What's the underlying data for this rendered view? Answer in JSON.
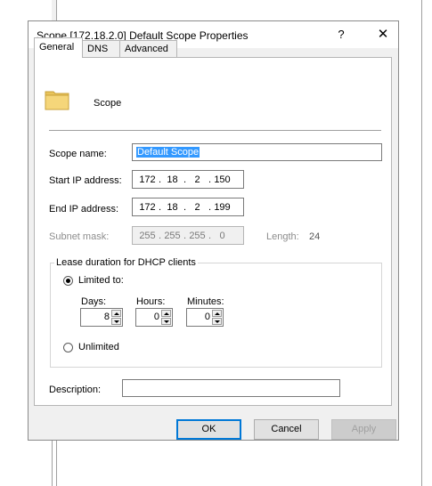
{
  "window": {
    "title": "Scope [172.18.2.0] Default Scope Properties",
    "help_glyph": "?",
    "close_glyph": "✕"
  },
  "tabs": [
    {
      "label": "General",
      "active": true
    },
    {
      "label": "DNS",
      "active": false
    },
    {
      "label": "Advanced",
      "active": false
    }
  ],
  "header": {
    "icon": "folder-icon",
    "label": "Scope"
  },
  "form": {
    "scope_name_label": "Scope name:",
    "scope_name_value": "Default Scope",
    "start_ip_label": "Start IP address:",
    "start_ip": [
      "172",
      "18",
      "2",
      "150"
    ],
    "end_ip_label": "End IP address:",
    "end_ip": [
      "172",
      "18",
      "2",
      "199"
    ],
    "subnet_label": "Subnet mask:",
    "subnet": [
      "255",
      "255",
      "255",
      "0"
    ],
    "length_label": "Length:",
    "length_value": "24"
  },
  "lease": {
    "group_label": "Lease duration for DHCP clients",
    "limited_label": "Limited to:",
    "days_label": "Days:",
    "days_value": "8",
    "hours_label": "Hours:",
    "hours_value": "0",
    "minutes_label": "Minutes:",
    "minutes_value": "0",
    "unlimited_label": "Unlimited"
  },
  "description": {
    "label": "Description:",
    "value": ""
  },
  "buttons": {
    "ok": "OK",
    "cancel": "Cancel",
    "apply": "Apply"
  },
  "colors": {
    "selection": "#3399ff",
    "default_button_border": "#0078d7",
    "dialog_bg": "#f0f0f0"
  }
}
